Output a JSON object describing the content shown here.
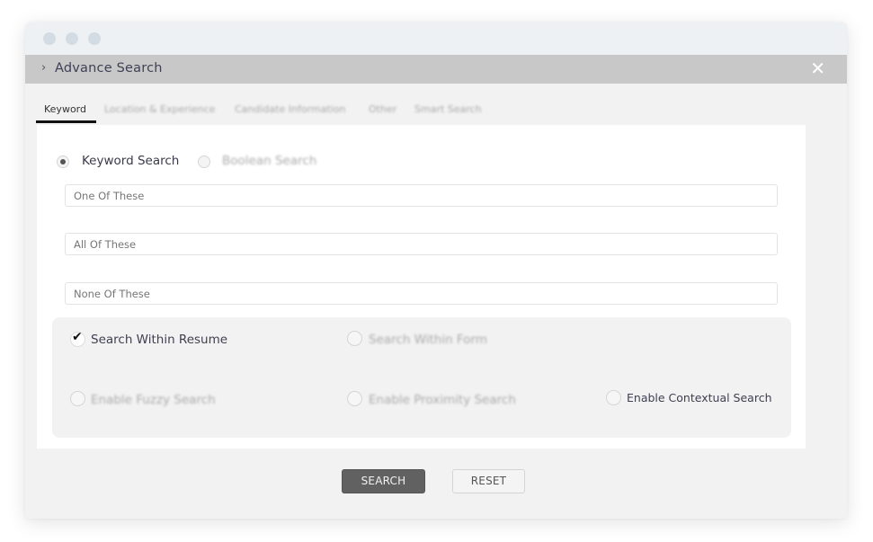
{
  "window": {
    "title": "Advance Search",
    "close_icon": "close-icon",
    "collapse_icon": "chevron-right-icon"
  },
  "tabs": [
    {
      "label": "Keyword",
      "active": true
    },
    {
      "label": "Location & Experience",
      "active": false
    },
    {
      "label": "Candidate Information",
      "active": false
    },
    {
      "label": "Other",
      "active": false
    },
    {
      "label": "Smart Search",
      "active": false
    }
  ],
  "search_mode": {
    "options": [
      {
        "label": "Keyword Search",
        "checked": true
      },
      {
        "label": "Boolean Search",
        "checked": false
      }
    ]
  },
  "fields": [
    {
      "placeholder": "One Of These",
      "value": ""
    },
    {
      "placeholder": "All Of These",
      "value": ""
    },
    {
      "placeholder": "None Of These",
      "value": ""
    }
  ],
  "options": [
    {
      "label": "Search Within Resume",
      "checked": true
    },
    {
      "label": "Search Within Form",
      "checked": false
    },
    {
      "label": "Enable Fuzzy Search",
      "checked": false
    },
    {
      "label": "Enable Proximity Search",
      "checked": false
    },
    {
      "label": "Enable Contextual Search",
      "checked": false
    }
  ],
  "buttons": {
    "search": "SEARCH",
    "reset": "RESET"
  },
  "icons": {
    "close": "✕",
    "chevron": "›"
  },
  "colors": {
    "header_bg": "#c8c8c8",
    "primary_button": "#616161",
    "active_tab_underline": "#111111"
  }
}
